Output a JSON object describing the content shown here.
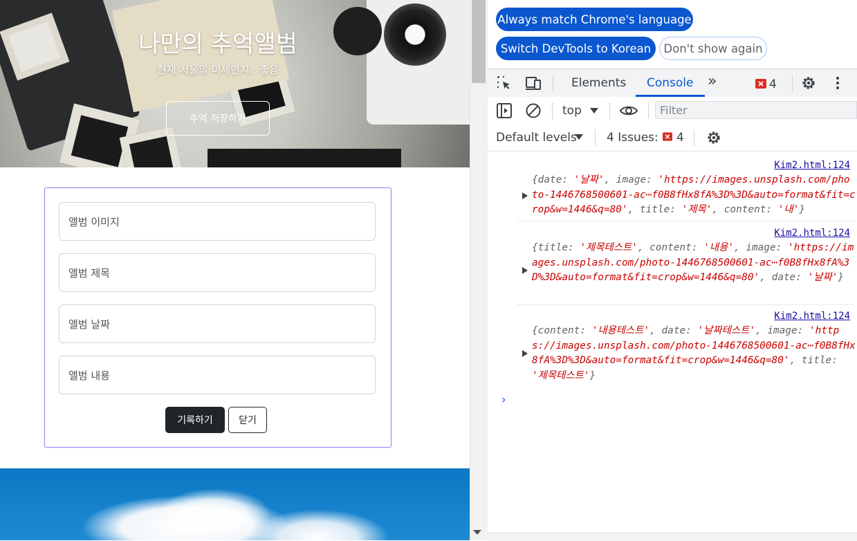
{
  "page": {
    "hero": {
      "title": "나만의 추억앨범",
      "subtitle": "현재 서울의 미세먼지 : 좋음",
      "save_button": "추억 저장하기"
    },
    "form": {
      "image_placeholder": "앨범 이미지",
      "title_placeholder": "앨범 제목",
      "date_placeholder": "앨범 날짜",
      "content_placeholder": "앨범 내용",
      "submit_label": "기록하기",
      "close_label": "닫기"
    }
  },
  "devtools": {
    "infobar": {
      "match_language": "Always match Chrome's language",
      "switch_korean": "Switch DevTools to Korean",
      "dont_show": "Don't show again"
    },
    "tabs": {
      "elements": "Elements",
      "console": "Console",
      "more": "»",
      "error_count": "4"
    },
    "console_toolbar": {
      "context": "top",
      "filter_placeholder": "Filter",
      "levels": "Default levels",
      "issues_label": "4 Issues:",
      "issues_count": "4"
    },
    "logs": [
      {
        "source": "Kim2.html:124",
        "parts": [
          {
            "t": "{",
            "c": "k"
          },
          {
            "t": "date",
            "c": "k"
          },
          {
            "t": ": ",
            "c": "k"
          },
          {
            "t": "'날짜'",
            "c": "s"
          },
          {
            "t": ", ",
            "c": "k"
          },
          {
            "t": "image",
            "c": "k"
          },
          {
            "t": ": ",
            "c": "k"
          },
          {
            "t": "'https://images.unsplash.com/photo-1446768500601-ac⋯f0B8fHx8fA%3D%3D&auto=format&fit=crop&w=1446&q=80'",
            "c": "s"
          },
          {
            "t": ", ",
            "c": "k"
          },
          {
            "t": "title",
            "c": "k"
          },
          {
            "t": ": ",
            "c": "k"
          },
          {
            "t": "'제목'",
            "c": "s"
          },
          {
            "t": ", ",
            "c": "k"
          },
          {
            "t": "content",
            "c": "k"
          },
          {
            "t": ": ",
            "c": "k"
          },
          {
            "t": "'내'",
            "c": "s"
          },
          {
            "t": "}",
            "c": "k"
          }
        ]
      },
      {
        "source": "Kim2.html:124",
        "parts": [
          {
            "t": "{",
            "c": "k"
          },
          {
            "t": "title",
            "c": "k"
          },
          {
            "t": ": ",
            "c": "k"
          },
          {
            "t": "'제목테스트'",
            "c": "s"
          },
          {
            "t": ", ",
            "c": "k"
          },
          {
            "t": "content",
            "c": "k"
          },
          {
            "t": ": ",
            "c": "k"
          },
          {
            "t": "'내용'",
            "c": "s"
          },
          {
            "t": ", ",
            "c": "k"
          },
          {
            "t": "image",
            "c": "k"
          },
          {
            "t": ": ",
            "c": "k"
          },
          {
            "t": "'https://images.unsplash.com/photo-1446768500601-ac⋯f0B8fHx8fA%3D%3D&auto=format&fit=crop&w=1446&q=80'",
            "c": "s"
          },
          {
            "t": ", ",
            "c": "k"
          },
          {
            "t": "date",
            "c": "k"
          },
          {
            "t": ": ",
            "c": "k"
          },
          {
            "t": "'날짜'",
            "c": "s"
          },
          {
            "t": "}",
            "c": "k"
          }
        ]
      },
      {
        "source": "Kim2.html:124",
        "parts": [
          {
            "t": "{",
            "c": "k"
          },
          {
            "t": "content",
            "c": "k"
          },
          {
            "t": ": ",
            "c": "k"
          },
          {
            "t": "'내용테스트'",
            "c": "s"
          },
          {
            "t": ", ",
            "c": "k"
          },
          {
            "t": "date",
            "c": "k"
          },
          {
            "t": ": ",
            "c": "k"
          },
          {
            "t": "'날짜테스트'",
            "c": "s"
          },
          {
            "t": ", ",
            "c": "k"
          },
          {
            "t": "image",
            "c": "k"
          },
          {
            "t": ": ",
            "c": "k"
          },
          {
            "t": "'https://images.unsplash.com/photo-1446768500601-ac⋯f0B8fHx8fA%3D%3D&auto=format&fit=crop&w=1446&q=80'",
            "c": "s"
          },
          {
            "t": ", ",
            "c": "k"
          },
          {
            "t": "title",
            "c": "k"
          },
          {
            "t": ": ",
            "c": "k"
          },
          {
            "t": "'제목테스트'",
            "c": "s"
          },
          {
            "t": "}",
            "c": "k"
          }
        ]
      }
    ],
    "prompt_symbol": "›",
    "colors": {
      "accent": "#0b57d0",
      "string": "#c80000",
      "error": "#d93025"
    }
  }
}
